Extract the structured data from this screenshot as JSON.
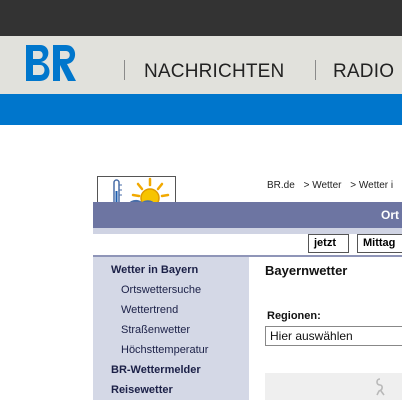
{
  "site": {
    "logo_text": "BR",
    "nav": [
      "NACHRICHTEN",
      "RADIO"
    ]
  },
  "colors": {
    "topbar": "#333333",
    "header_bg": "#e1e1dc",
    "logo": "#0076cc",
    "blue_band": "#0076cc",
    "slate_bar": "#6d75a2",
    "sidebar_bg": "#d4d8e6"
  },
  "breadcrumb": [
    "BR.de",
    "> Wetter",
    "> Wetter i"
  ],
  "slate_bar_text": "Ort",
  "tabs": [
    "jetzt",
    "Mittag"
  ],
  "sidebar": {
    "items": [
      {
        "label": "Wetter in Bayern",
        "level": "main"
      },
      {
        "label": "Ortswettersuche",
        "level": "sub"
      },
      {
        "label": "Wettertrend",
        "level": "sub"
      },
      {
        "label": "Straßenwetter",
        "level": "sub"
      },
      {
        "label": "Höchsttemperatur",
        "level": "sub"
      },
      {
        "label": "BR-Wettermelder",
        "level": "main"
      },
      {
        "label": "Reisewetter",
        "level": "main"
      }
    ]
  },
  "main": {
    "title": "Bayernwetter",
    "regions_label": "Regionen:",
    "regions_selected": "Hier auswählen"
  },
  "icons": {
    "weather_logo": "thermometer-sun-cloud-icon"
  }
}
